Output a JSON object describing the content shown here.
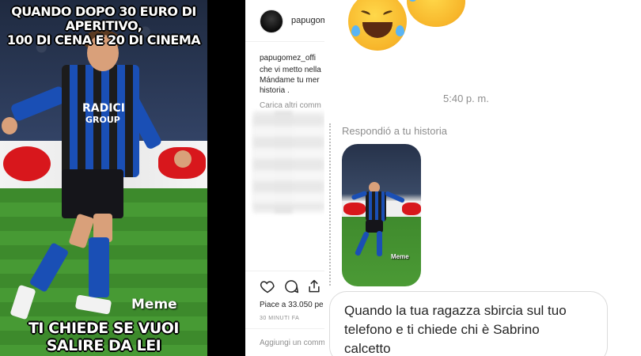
{
  "meme": {
    "top_caption_line1": "QUANDO DOPO 30 EURO DI APERITIVO,",
    "top_caption_line2": "100 DI CENA E 20 DI CINEMA",
    "bottom_caption_line1": "TI CHIEDE SE VUOI",
    "bottom_caption_line2": "SALIRE DA LEI",
    "watermark": "Meme",
    "shirt_sponsor_line1": "RADICI",
    "shirt_sponsor_line2": "GROUP"
  },
  "instagram_post": {
    "username": "papugom",
    "caption_username": "papugomez_offi",
    "caption_line1": "che vi metto nella",
    "caption_line2": "Mándame tu mer",
    "caption_line3": "historia .",
    "load_more": "Carica altri comm",
    "likes": "Piace a 33.050 pe",
    "timestamp": "30 MINUTI FA",
    "comment_placeholder": "Aggiungi un comm"
  },
  "dm_chat": {
    "time": "5:40 p. m.",
    "reply_label": "Respondió a tu historia",
    "story_watermark": "Meme",
    "message_line1": "Quando la tua ragazza sbircia sul tuo",
    "message_line2": "telefono e ti chiede chi è Sabrino",
    "message_line3": "calcetto"
  },
  "colors": {
    "instagram_text": "#262626",
    "instagram_muted": "#8e8e8e",
    "atalanta_blue": "#1a4fb5",
    "atalanta_black": "#1c1c1c"
  }
}
